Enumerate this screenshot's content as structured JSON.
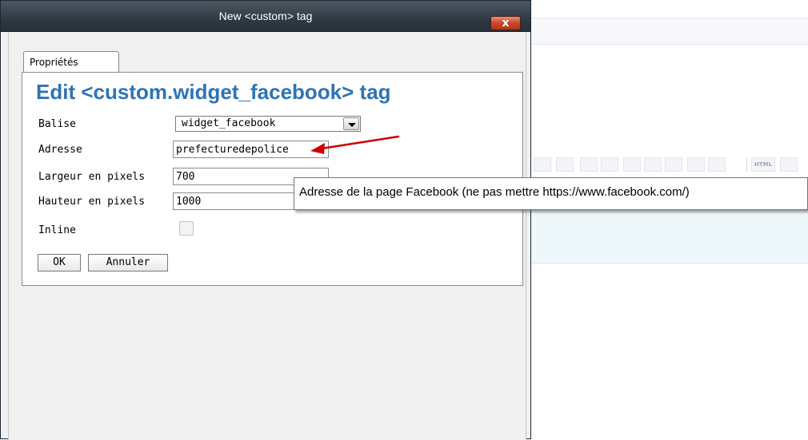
{
  "dialog": {
    "title": "New <custom> tag",
    "close_label": "x",
    "tab_label": "Propriétés",
    "heading": "Edit <custom.widget_facebook> tag"
  },
  "form": {
    "balise_label": "Balise",
    "balise_value": "widget_facebook",
    "adresse_label": "Adresse",
    "adresse_value": "prefecturedepolice",
    "largeur_label": "Largeur en pixels",
    "largeur_value": "700",
    "hauteur_label": "Hauteur en pixels",
    "hauteur_value": "1000",
    "inline_label": "Inline",
    "inline_checked": false
  },
  "buttons": {
    "ok_label": "OK",
    "cancel_label": "Annuler"
  },
  "tooltip": {
    "text": "Adresse de la page Facebook (ne pas mettre https://www.facebook.com/)"
  },
  "background_editor": {
    "html_button_label": "HTML"
  },
  "colors": {
    "heading": "#2e74b5",
    "arrow": "#cc0000",
    "titlebar": "#333e48",
    "close_button": "#c9472c"
  },
  "icons": {
    "close": "close-icon",
    "dropdown": "chevron-down-icon",
    "annotation": "red-arrow-icon"
  }
}
